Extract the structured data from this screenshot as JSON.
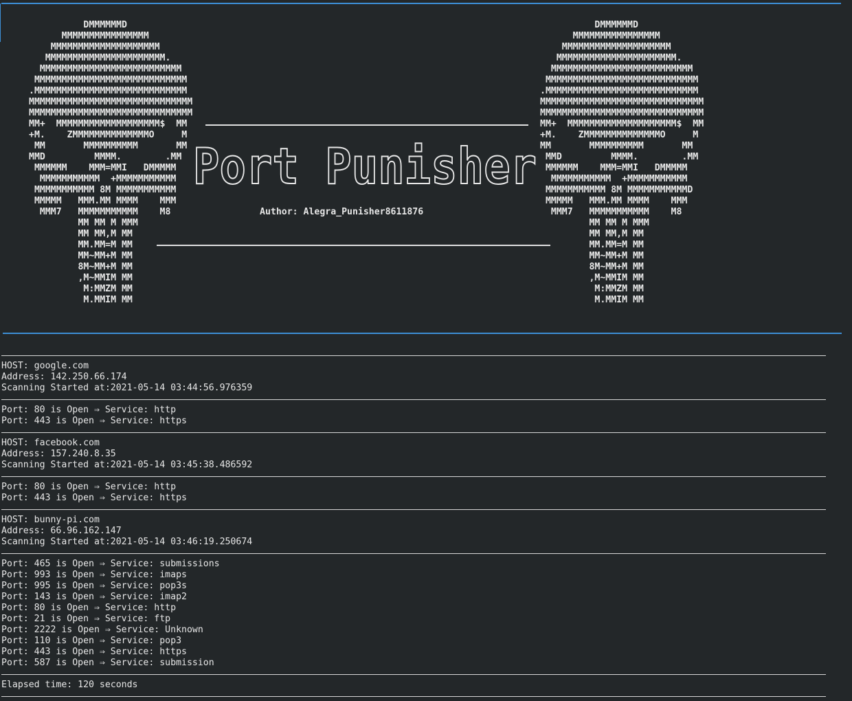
{
  "theme": {
    "background": "#232729",
    "rule_color": "#3d8fd6",
    "text_color": "#e6e6e6"
  },
  "banner": {
    "skull_left": "          DMMMMMMD\n      MMMMMMMMMMMMMMMM\n    MMMMMMMMMMMMMMMMMMMM\n   MMMMMMMMMMMMMMMMMMMMMM.\n  MMMMMMMMMMMMMMMMMMMMMMMMMM\n MMMMMMMMMMMMMMMMMMMMMMMMMMMM\n.MMMMMMMMMMMMMMMMMMMMMMMMMMMM\nMMMMMMMMMMMMMMMMMMMMMMMMMMMMMM\nMMMMMMMMMMMMMMMMMMMMMMMMMMMMMM\nMM+  MMMMMMMMMMMMMMMMMMM$  MM\n+M.    ZMMMMMMMMMMMMMMO     M\n MM       MMMMMMMMMM       MM\nMMD         MMMM.        .MM\n MMMMMM    MMM=MMI   DMMMMM\n  MMMMMMMMMMM  +MMMMMMMMMMM\n MMMMMMMMMMM 8M MMMMMMMMMMM\n MMMMM   MMM.MM MMMM    MMM\n  MMM7   MMMMMMMMMMM    M8\n         MM MM M MMM\n         MM MM,M MM\n         MM.MM=M MM\n         MM~MM+M MM\n         8M~MM+M MM\n         ,M~MMIM MM\n          M:MMZM MM\n          M.MMIM MM",
    "skull_right": "          DMMMMMMD\n      MMMMMMMMMMMMMMMM\n    MMMMMMMMMMMMMMMMMMMM\n   MMMMMMMMMMMMMMMMMMMMMM.\n  MMMMMMMMMMMMMMMMMMMMMMMMMM\n MMMMMMMMMMMMMMMMMMMMMMMMMMMM\n.MMMMMMMMMMMMMMMMMMMMMMMMMMMM\nMMMMMMMMMMMMMMMMMMMMMMMMMMMMMM\nMMMMMMMMMMMMMMMMMMMMMMMMMMMMMM\nMM+  MMMMMMMMMMMMMMMMMMMM$  MM\n+M.    ZMMMMMMMMMMMMMMO     M\nMM       MMMMMMMMMM       MM\n MMD         MMMM.        .MM\n MMMMMM    MMM=MMI   DMMMMM\n  MMMMMMMMMMM  +MMMMMMMMMMM\n MMMMMMMMMMM 8M MMMMMMMMMMMD\n MMMMM   MMM.MM MMMM    MMM\n  MMM7   MMMMMMMMMMM    M8\n         MM MM M MMM\n         MM MM,M MM\n         MM.MM=M MM\n         MM~MM+M MM\n         8M~MM+M MM\n         ,M~MMIM MM\n          M:MMZM MM\n          M.MMIM MM",
    "logo_text": "Port Punisher",
    "author": "Author: Alegra_Punisher8611876"
  },
  "hosts": [
    {
      "host_line": "HOST: google.com",
      "address_line": "Address: 142.250.66.174",
      "started_line": "Scanning Started at:2021-05-14 03:44:56.976359",
      "ports": [
        "Port: 80 is Open ⇒ Service: http",
        "Port: 443 is Open ⇒ Service: https"
      ]
    },
    {
      "host_line": "HOST: facebook.com",
      "address_line": "Address: 157.240.8.35",
      "started_line": "Scanning Started at:2021-05-14 03:45:38.486592",
      "ports": [
        "Port: 80 is Open ⇒ Service: http",
        "Port: 443 is Open ⇒ Service: https"
      ]
    },
    {
      "host_line": "HOST: bunny-pi.com",
      "address_line": "Address: 66.96.162.147",
      "started_line": "Scanning Started at:2021-05-14 03:46:19.250674",
      "ports": [
        "Port: 465 is Open ⇒ Service: submissions",
        "Port: 993 is Open ⇒ Service: imaps",
        "Port: 995 is Open ⇒ Service: pop3s",
        "Port: 143 is Open ⇒ Service: imap2",
        "Port: 80 is Open ⇒ Service: http",
        "Port: 21 is Open ⇒ Service: ftp",
        "Port: 2222 is Open ⇒ Service: Unknown",
        "Port: 110 is Open ⇒ Service: pop3",
        "Port: 443 is Open ⇒ Service: https",
        "Port: 587 is Open ⇒ Service: submission"
      ]
    }
  ],
  "elapsed": "Elapsed time: 120 seconds"
}
